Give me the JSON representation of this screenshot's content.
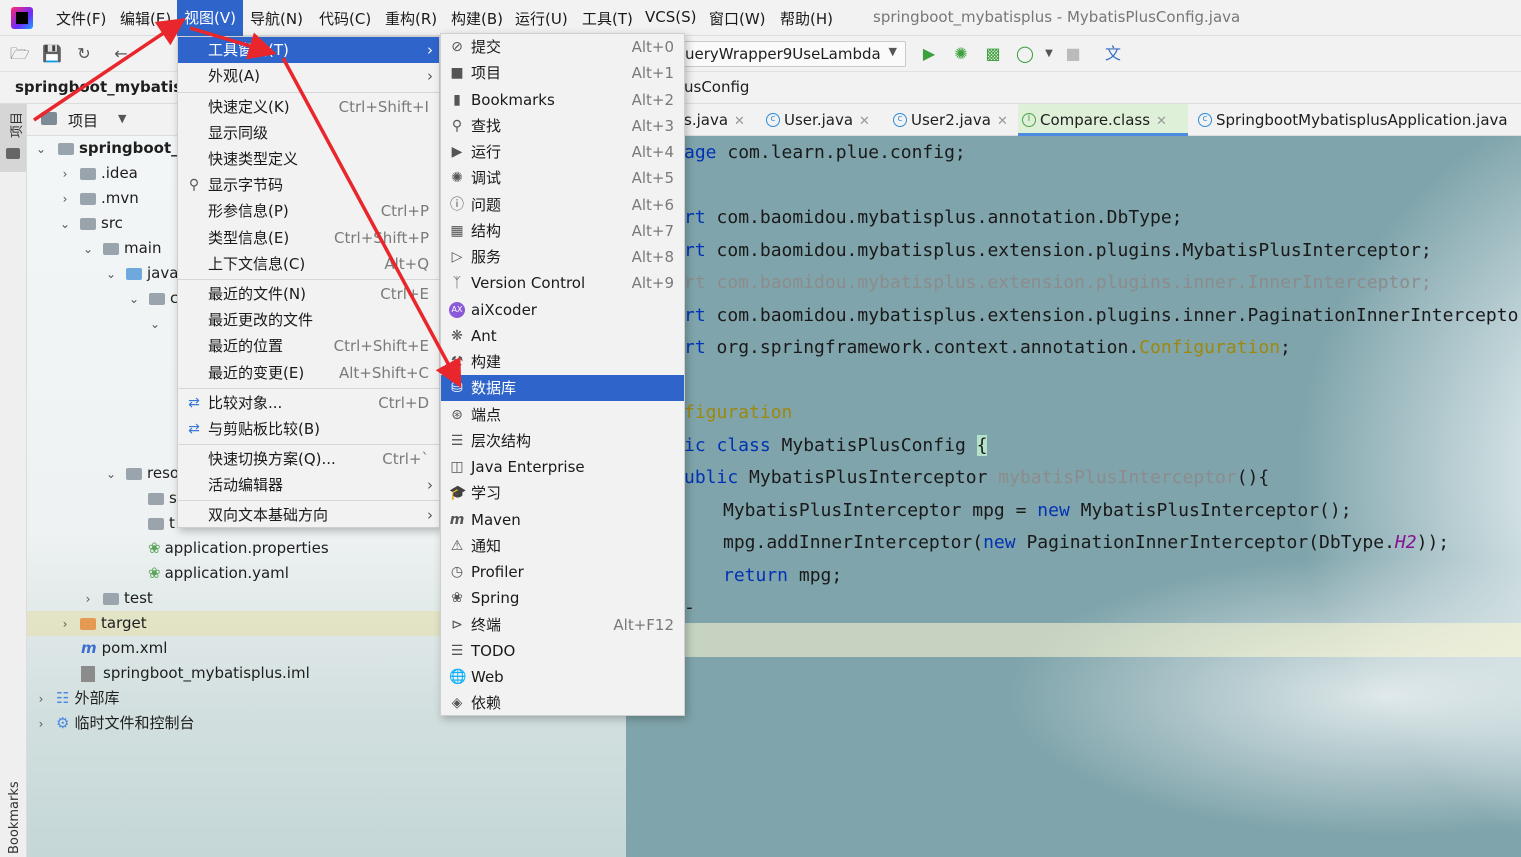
{
  "menubar": {
    "items": [
      "文件(F)",
      "编辑(E)",
      "视图(V)",
      "导航(N)",
      "代码(C)",
      "重构(R)",
      "构建(B)",
      "运行(U)",
      "工具(T)",
      "VCS(S)",
      "窗口(W)",
      "帮助(H)"
    ],
    "title": "springboot_mybatisplus - MybatisPlusConfig.java"
  },
  "toolbar": {
    "run_config": "ueryWrapper9UseLambda"
  },
  "breadcrumb": {
    "project": "springboot_mybatisp",
    "file": "usConfig"
  },
  "sidebar": {
    "project_tab": "项目",
    "bookmarks_tab": "Bookmarks"
  },
  "project_panel": {
    "header": "项目",
    "tree": [
      {
        "label": "springboot_m"
      },
      {
        "label": ".idea"
      },
      {
        "label": ".mvn"
      },
      {
        "label": "src"
      },
      {
        "label": "main"
      },
      {
        "label": "java"
      },
      {
        "label": "c"
      },
      {
        "label": "reso"
      },
      {
        "label": "s"
      },
      {
        "label": "t"
      },
      {
        "label": "application.properties"
      },
      {
        "label": "application.yaml"
      },
      {
        "label": "test"
      },
      {
        "label": "target"
      },
      {
        "label": "pom.xml"
      },
      {
        "label": "springboot_mybatisplus.iml"
      },
      {
        "label": "外部库"
      },
      {
        "label": "临时文件和控制台"
      }
    ]
  },
  "tabs": [
    "s.java",
    "User.java",
    "User2.java",
    "Compare.class",
    "SpringbootMybatisplusApplication.java"
  ],
  "code": {
    "l1a": "age ",
    "l1b": "com.learn.plue.config;",
    "l2a": "rt ",
    "l2b": "com.baomidou.mybatisplus.annotation.DbType;",
    "l3a": "rt ",
    "l3b": "com.baomidou.mybatisplus.extension.plugins.MybatisPlusInterceptor;",
    "l4": "rt com.baomidou.mybatisplus.extension.plugins.inner.InnerInterceptor;",
    "l5a": "rt ",
    "l5b": "com.baomidou.mybatisplus.extension.plugins.inner.PaginationInnerIntercepto",
    "l6a": "rt ",
    "l6b": "org.springframework.context.annotation.",
    "l6c": "Configuration",
    ";": ";",
    "l7": "figuration",
    "l8a": "ic class ",
    "l8b": "MybatisPlusConfig ",
    "l8c": "{",
    "l9a": "ublic ",
    "l9b": "MybatisPlusInterceptor ",
    "l9c": "mybatisPlusInterceptor",
    "l9d": "(){",
    "l10a": "MybatisPlusInterceptor mpg = ",
    "l10b": "new ",
    "l10c": "MybatisPlusInterceptor();",
    "l11a": "mpg.addInnerInterceptor(",
    "l11b": "new ",
    "l11c": "PaginationInnerInterceptor(DbType.",
    "l11d": "H2",
    "l11e": "));",
    "l12a": "return ",
    "l12b": "mpg;",
    "l13": "-"
  },
  "view_menu": [
    {
      "label": "工具窗口(T)",
      "shortcut": "",
      "submenu": true,
      "highlight": true
    },
    {
      "label": "外观(A)",
      "shortcut": "",
      "submenu": true
    },
    {
      "label": "快速定义(K)",
      "shortcut": "Ctrl+Shift+I"
    },
    {
      "label": "显示同级",
      "shortcut": ""
    },
    {
      "label": "快速类型定义",
      "shortcut": ""
    },
    {
      "label": "显示字节码",
      "shortcut": ""
    },
    {
      "label": "形参信息(P)",
      "shortcut": "Ctrl+P"
    },
    {
      "label": "类型信息(E)",
      "shortcut": "Ctrl+Shift+P"
    },
    {
      "label": "上下文信息(C)",
      "shortcut": "Alt+Q"
    },
    {
      "label": "最近的文件(N)",
      "shortcut": "Ctrl+E"
    },
    {
      "label": "最近更改的文件",
      "shortcut": ""
    },
    {
      "label": "最近的位置",
      "shortcut": "Ctrl+Shift+E"
    },
    {
      "label": "最近的变更(E)",
      "shortcut": "Alt+Shift+C"
    },
    {
      "label": "比较对象...",
      "shortcut": "Ctrl+D"
    },
    {
      "label": "与剪贴板比较(B)",
      "shortcut": ""
    },
    {
      "label": "快速切换方案(Q)...",
      "shortcut": "Ctrl+`"
    },
    {
      "label": "活动编辑器",
      "shortcut": "",
      "submenu": true
    },
    {
      "label": "双向文本基础方向",
      "shortcut": "",
      "submenu": true
    }
  ],
  "tool_windows_menu": [
    {
      "label": "提交",
      "shortcut": "Alt+0"
    },
    {
      "label": "项目",
      "shortcut": "Alt+1"
    },
    {
      "label": "Bookmarks",
      "shortcut": "Alt+2"
    },
    {
      "label": "查找",
      "shortcut": "Alt+3"
    },
    {
      "label": "运行",
      "shortcut": "Alt+4"
    },
    {
      "label": "调试",
      "shortcut": "Alt+5"
    },
    {
      "label": "问题",
      "shortcut": "Alt+6"
    },
    {
      "label": "结构",
      "shortcut": "Alt+7"
    },
    {
      "label": "服务",
      "shortcut": "Alt+8"
    },
    {
      "label": "Version Control",
      "shortcut": "Alt+9"
    },
    {
      "label": "aiXcoder",
      "shortcut": ""
    },
    {
      "label": "Ant",
      "shortcut": ""
    },
    {
      "label": "构建",
      "shortcut": ""
    },
    {
      "label": "数据库",
      "shortcut": "",
      "highlight": true
    },
    {
      "label": "端点",
      "shortcut": ""
    },
    {
      "label": "层次结构",
      "shortcut": ""
    },
    {
      "label": "Java Enterprise",
      "shortcut": ""
    },
    {
      "label": "学习",
      "shortcut": ""
    },
    {
      "label": "Maven",
      "shortcut": ""
    },
    {
      "label": "通知",
      "shortcut": ""
    },
    {
      "label": "Profiler",
      "shortcut": ""
    },
    {
      "label": "Spring",
      "shortcut": ""
    },
    {
      "label": "终端",
      "shortcut": "Alt+F12"
    },
    {
      "label": "TODO",
      "shortcut": ""
    },
    {
      "label": "Web",
      "shortcut": ""
    },
    {
      "label": "依赖",
      "shortcut": ""
    }
  ],
  "colors": {
    "accent": "#2f65ca",
    "arrow": "#e8262b"
  }
}
